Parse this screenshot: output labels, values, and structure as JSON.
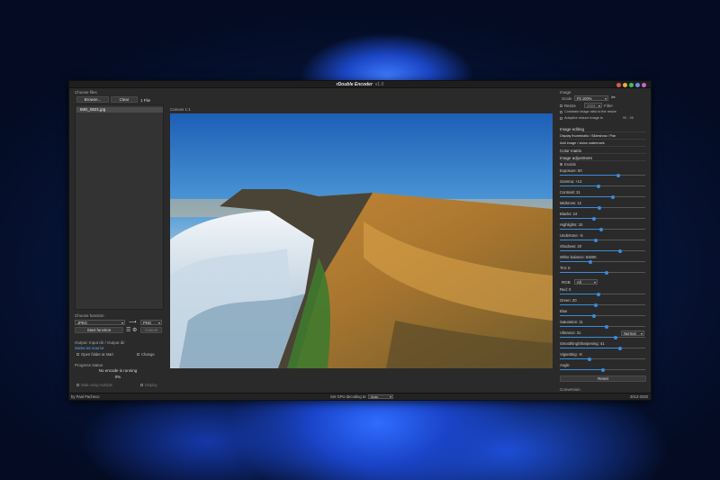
{
  "window": {
    "title": "rDouble Encoder",
    "version": "v1.0",
    "controls": [
      "#e05555",
      "#e0b040",
      "#3fbf5f",
      "#6a8fe0",
      "#cc66cc"
    ]
  },
  "left": {
    "choose_files_label": "Choose files",
    "browse_label": "Browse...",
    "clear_label": "Clear",
    "file_count": "1 File",
    "files": [
      "IMG_0021.jpg"
    ],
    "choose_function_label": "Choose function",
    "function_select": "JPEG",
    "output_select": "PNG",
    "start_label": "Start function",
    "cancel_label": "Cancel",
    "output_dir_label": "Output: Input dir / Output dir",
    "same_as_source": "Same as source",
    "open_folder_check": "Open folder at start",
    "change_label": "Change",
    "progress_label": "Progress status",
    "progress_status": "No encode is running",
    "progress_percent": "0%",
    "wait_check": "Wait using multiple",
    "display_check": "Display"
  },
  "center": {
    "label": "Canvas 1:1"
  },
  "right": {
    "image_label": "Image",
    "scale_label": "Scale",
    "scale_value": "Fit 100%",
    "resize_check": "Resize",
    "resize_value": "1024",
    "filter_label": "Filter",
    "keep_ratio_check": "Constrain image ratio to the resize",
    "adaptive_check": "Adaptive reduce image to",
    "adaptive_value": "90 - 95",
    "image_editing": "Image editing",
    "display_label": "Display thumbnails / Slideshow / Pan",
    "watermark_label": "Add image / vision watermark",
    "color_matrix": "Color matrix",
    "image_adjust": "Image adjustment",
    "enable_check": "Enable",
    "sliders": [
      {
        "label": "Exposure: 60",
        "value": 0.68
      },
      {
        "label": "Gamma: +14",
        "value": 0.45
      },
      {
        "label": "Contrast: 31",
        "value": 0.62
      },
      {
        "label": "Midtones: 12",
        "value": 0.46
      },
      {
        "label": "Blacks: 24",
        "value": 0.4
      },
      {
        "label": "Highlights: 10",
        "value": 0.48
      },
      {
        "label": "Undertone: -5",
        "value": 0.42
      },
      {
        "label": "Shadows: 20",
        "value": 0.7
      },
      {
        "label": "White balance: 6460K",
        "value": 0.36
      },
      {
        "label": "Tint: 5",
        "value": 0.55
      }
    ],
    "rgb_label": "RGB",
    "rgb_select": "All",
    "rgb_sliders": [
      {
        "label": "Red: 0",
        "value": 0.45
      },
      {
        "label": "Green: 20",
        "value": 0.42
      },
      {
        "label": "Blue",
        "value": 0.4
      },
      {
        "label": "Saturation: 11",
        "value": 0.55
      },
      {
        "label": "Vibrance: 31",
        "value": 0.65
      },
      {
        "label": "Smoothing/Sharpening: 41",
        "value": 0.7
      },
      {
        "label": "Vignetting: -8",
        "value": 0.35
      },
      {
        "label": "Angle",
        "value": 0.5
      }
    ],
    "vibrance_select": "Normal",
    "reset_label": "Reset",
    "conversion_label": "Conversion"
  },
  "status": {
    "author": "by Paul Pacheco",
    "gpu_label": "Set GPU decoding to:",
    "gpu_value": "Auto",
    "copyright": "2013-2020"
  }
}
